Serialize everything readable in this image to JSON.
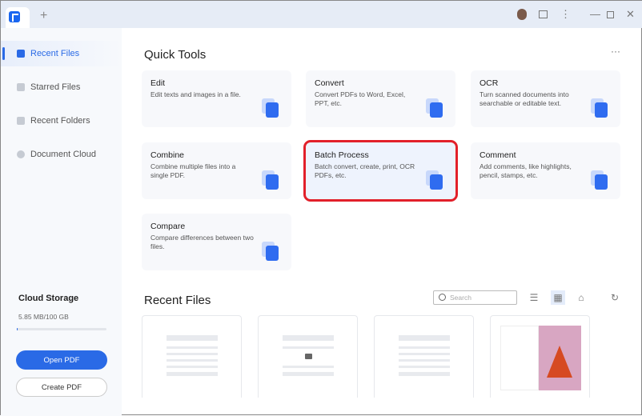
{
  "titlebar": {
    "new_tab": "+",
    "icons": [
      "app-logo",
      "avatar",
      "notification-icon",
      "more-icon",
      "minimize-icon",
      "maximize-icon",
      "close-icon"
    ]
  },
  "sidebar": {
    "items": [
      {
        "label": "Recent Files",
        "active": true
      },
      {
        "label": "Starred Files"
      },
      {
        "label": "Recent Folders"
      },
      {
        "label": "Document Cloud"
      }
    ],
    "cloud_storage": {
      "title": "Cloud Storage",
      "value": "5.85 MB/100 GB",
      "fraction": 0.0001
    },
    "open_pdf": "Open PDF",
    "create_pdf": "Create PDF"
  },
  "quick_tools": {
    "title": "Quick Tools",
    "more": "···",
    "tools": [
      {
        "title": "Edit",
        "desc": "Edit texts and images in a file."
      },
      {
        "title": "Convert",
        "desc": "Convert PDFs to Word, Excel, PPT, etc."
      },
      {
        "title": "OCR",
        "desc": "Turn scanned documents into searchable or editable text."
      },
      {
        "title": "Combine",
        "desc": "Combine multiple files into a single PDF."
      },
      {
        "title": "Batch Process",
        "desc": "Batch convert, create, print, OCR PDFs, etc.",
        "highlighted": true
      },
      {
        "title": "Comment",
        "desc": "Add comments, like highlights, pencil, stamps, etc."
      },
      {
        "title": "Compare",
        "desc": "Compare differences between two files."
      }
    ]
  },
  "recent_files": {
    "title": "Recent Files",
    "search_placeholder": "Search",
    "accent": "#2a6ae6",
    "highlight": "#e2202a"
  }
}
